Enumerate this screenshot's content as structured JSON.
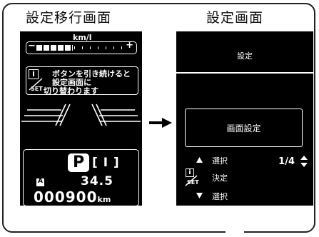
{
  "titles": {
    "left": "設定移行画面",
    "right": "設定画面"
  },
  "left_display": {
    "fuel_unit": "km/l",
    "gauge_minus": "−",
    "gauge_plus": "+",
    "gauge_level": 0.4,
    "info_icon_letter": "i",
    "set_label": "SET",
    "message_lines": [
      "ボタンを引き続けると",
      "設定画面に",
      "切り替わります"
    ],
    "gear": "P",
    "gear_suffix": "[ I ]",
    "auto_icon": "A",
    "distance": "34.5",
    "odometer": "000900",
    "odometer_unit": "km"
  },
  "right_display": {
    "header": "設定",
    "selected_item": "画面設定",
    "up_label": "選択",
    "page": "1/4",
    "confirm_label": "決定",
    "down_label": "選択",
    "info_icon_letter": "i",
    "set_label": "SET"
  },
  "icons": {
    "transition_arrow": "right-arrow-icon",
    "up_triangle": "triangle-up-icon",
    "down_triangle": "triangle-down-icon",
    "updown_indicator": "up-down-arrows-icon"
  }
}
